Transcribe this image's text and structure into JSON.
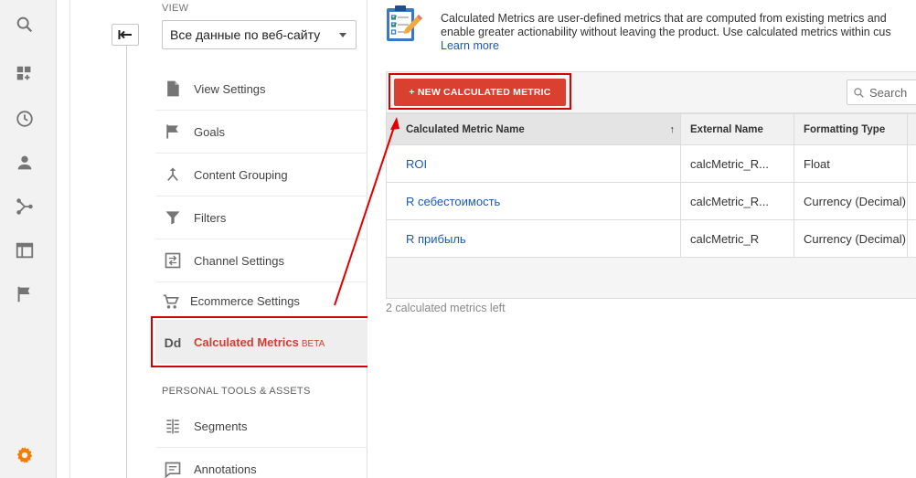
{
  "rail": {
    "icons": [
      "search-icon",
      "dashboard-icon",
      "clock-icon",
      "person-icon",
      "acquisition-icon",
      "behavior-icon",
      "flag-icon",
      "gear-icon"
    ]
  },
  "nav": {
    "view_label": "VIEW",
    "view_value": "Все данные по веб-сайту",
    "items": [
      {
        "label": "View Settings",
        "icon": "document-icon"
      },
      {
        "label": "Goals",
        "icon": "flag-icon"
      },
      {
        "label": "Content Grouping",
        "icon": "merge-icon"
      },
      {
        "label": "Filters",
        "icon": "filter-icon"
      },
      {
        "label": "Channel Settings",
        "icon": "channel-icon"
      },
      {
        "label": "Ecommerce Settings",
        "icon": "cart-icon"
      },
      {
        "label": "Calculated Metrics",
        "icon": "dd-icon",
        "icon_text": "Dd",
        "badge": "BETA"
      }
    ],
    "section_label": "PERSONAL TOOLS & ASSETS",
    "tools": [
      {
        "label": "Segments",
        "icon": "segments-icon"
      },
      {
        "label": "Annotations",
        "icon": "annotation-icon"
      }
    ]
  },
  "header": {
    "line1": "Calculated Metrics are user-defined metrics that are computed from existing metrics and",
    "line2": "enable greater actionability without leaving the product. Use calculated metrics within cus",
    "learn_more": "Learn more"
  },
  "toolbar": {
    "new_button": "+ NEW CALCULATED METRIC",
    "search_placeholder": "Search"
  },
  "table": {
    "columns": [
      "Calculated Metric Name",
      "External Name",
      "Formatting Type"
    ],
    "sort_indicator": "↑",
    "rows": [
      {
        "name": "ROI",
        "external": "calcMetric_R...",
        "format": "Float"
      },
      {
        "name": "R себестоимость",
        "external": "calcMetric_R...",
        "format": "Currency (Decimal)"
      },
      {
        "name": "R прибыль",
        "external": "calcMetric_R",
        "format": "Currency (Decimal)"
      }
    ]
  },
  "footer_note": "2 calculated metrics left",
  "colors": {
    "accent_red": "#d9402f",
    "highlight_red": "#d30000",
    "link_blue": "#1a5ab8",
    "orange_gear": "#f57c00"
  }
}
